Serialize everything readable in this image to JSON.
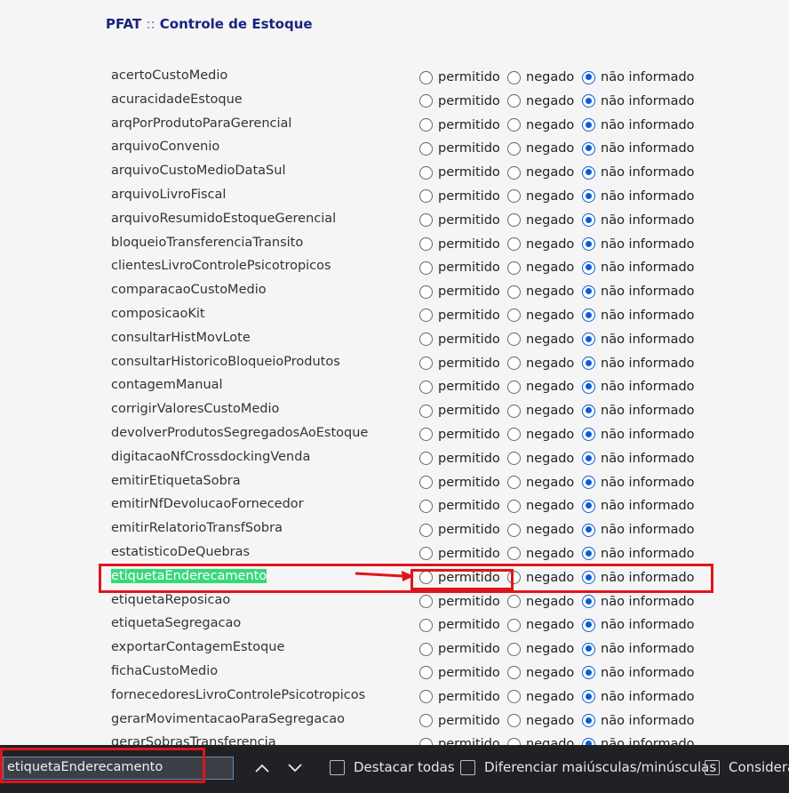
{
  "header": {
    "app": "PFAT",
    "separator": "::",
    "title": "Controle de Estoque"
  },
  "options": {
    "allowed": "permitido",
    "denied": "negado",
    "unset": "não informado"
  },
  "permissions": [
    {
      "name": "acertoCustoMedio",
      "value": "unset"
    },
    {
      "name": "acuracidadeEstoque",
      "value": "unset"
    },
    {
      "name": "arqPorProdutoParaGerencial",
      "value": "unset"
    },
    {
      "name": "arquivoConvenio",
      "value": "unset"
    },
    {
      "name": "arquivoCustoMedioDataSul",
      "value": "unset"
    },
    {
      "name": "arquivoLivroFiscal",
      "value": "unset"
    },
    {
      "name": "arquivoResumidoEstoqueGerencial",
      "value": "unset"
    },
    {
      "name": "bloqueioTransferenciaTransito",
      "value": "unset"
    },
    {
      "name": "clientesLivroControlePsicotropicos",
      "value": "unset"
    },
    {
      "name": "comparacaoCustoMedio",
      "value": "unset"
    },
    {
      "name": "composicaoKit",
      "value": "unset"
    },
    {
      "name": "consultarHistMovLote",
      "value": "unset"
    },
    {
      "name": "consultarHistoricoBloqueioProdutos",
      "value": "unset"
    },
    {
      "name": "contagemManual",
      "value": "unset"
    },
    {
      "name": "corrigirValoresCustoMedio",
      "value": "unset"
    },
    {
      "name": "devolverProdutosSegregadosAoEstoque",
      "value": "unset"
    },
    {
      "name": "digitacaoNfCrossdockingVenda",
      "value": "unset"
    },
    {
      "name": "emitirEtiquetaSobra",
      "value": "unset"
    },
    {
      "name": "emitirNfDevolucaoFornecedor",
      "value": "unset"
    },
    {
      "name": "emitirRelatorioTransfSobra",
      "value": "unset"
    },
    {
      "name": "estatisticoDeQuebras",
      "value": "unset"
    },
    {
      "name": "etiquetaEnderecamento",
      "value": "unset",
      "highlighted": true
    },
    {
      "name": "etiquetaReposicao",
      "value": "unset"
    },
    {
      "name": "etiquetaSegregacao",
      "value": "unset"
    },
    {
      "name": "exportarContagemEstoque",
      "value": "unset"
    },
    {
      "name": "fichaCustoMedio",
      "value": "unset"
    },
    {
      "name": "fornecedoresLivroControlePsicotropicos",
      "value": "unset"
    },
    {
      "name": "gerarMovimentacaoParaSegregacao",
      "value": "unset"
    },
    {
      "name": "gerarSobrasTransferencia",
      "value": "unset"
    }
  ],
  "findbar": {
    "query": "etiquetaEnderecamento",
    "prev_icon": "chevron-up-icon",
    "next_icon": "chevron-down-icon",
    "highlight_all": "Destacar todas",
    "match_case": "Diferenciar maiúsculas/minúsculas",
    "diacritics": "Considera"
  },
  "colors": {
    "title": "#1a237e",
    "radio_selected": "#0b5cd6",
    "highlight": "#38d878",
    "annotation_red": "#e0151c",
    "findbar_bg": "#202124"
  }
}
